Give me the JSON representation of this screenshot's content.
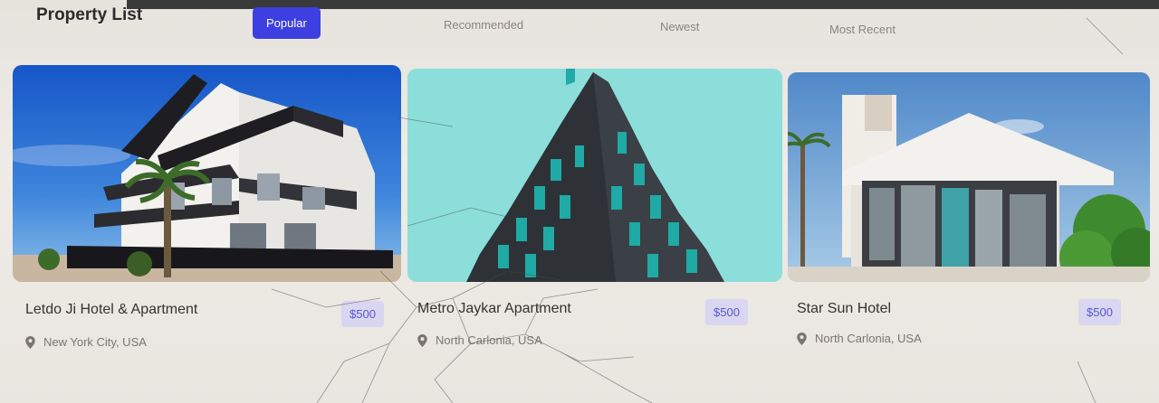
{
  "header": {
    "title": "Property List",
    "tabs": [
      {
        "label": "Popular",
        "active": true
      },
      {
        "label": "Recommended",
        "active": false
      },
      {
        "label": "Newest",
        "active": false
      },
      {
        "label": "Most Recent",
        "active": false
      }
    ]
  },
  "listings": [
    {
      "name": "Letdo Ji Hotel & Apartment",
      "price": "$500",
      "location": "New York City, USA"
    },
    {
      "name": "Metro Jaykar Apartment",
      "price": "$500",
      "location": "North Carlonia, USA"
    },
    {
      "name": "Star Sun Hotel",
      "price": "$500",
      "location": "North Carlonia, USA"
    }
  ],
  "colors": {
    "accent": "#3d3fe0",
    "price_badge_bg": "#d9d6f2",
    "price_text": "#5a57c9"
  },
  "icons": {
    "location": "map-pin-icon"
  }
}
